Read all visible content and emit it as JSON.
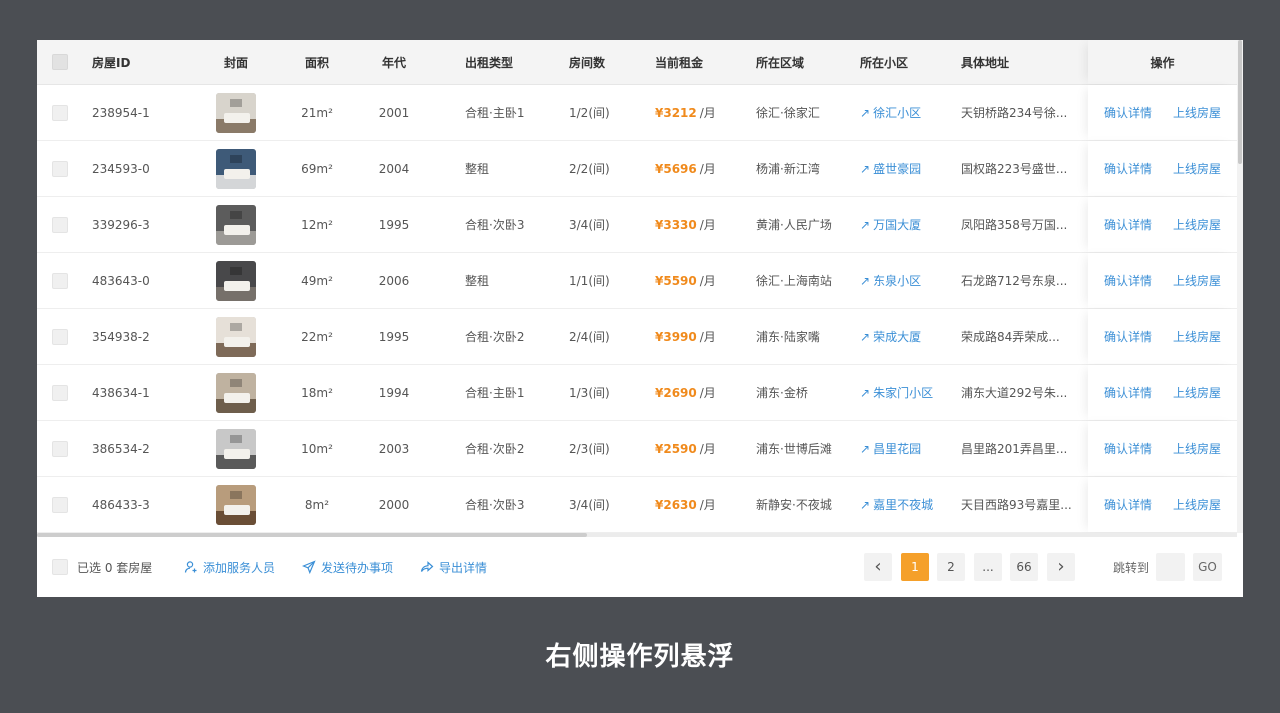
{
  "table": {
    "headers": {
      "house_id": "房屋ID",
      "cover": "封面",
      "area": "面积",
      "year": "年代",
      "rent_type": "出租类型",
      "rooms": "房间数",
      "rent": "当前租金",
      "district": "所在区域",
      "community": "所在小区",
      "address": "具体地址",
      "actions": "操作"
    },
    "rows": [
      {
        "id": "238954-1",
        "area": "21m²",
        "year": "2001",
        "rent_type": "合租·主卧1",
        "rooms": "1/2(间)",
        "price": "¥3212",
        "unit": "/月",
        "district": "徐汇·徐家汇",
        "community": "徐汇小区",
        "address": "天钥桥路234号徐...",
        "action1": "确认详情",
        "action2": "上线房屋",
        "img_wall": "#d8d4cc",
        "img_floor": "#8a7a68"
      },
      {
        "id": "234593-0",
        "area": "69m²",
        "year": "2004",
        "rent_type": "整租",
        "rooms": "2/2(间)",
        "price": "¥5696",
        "unit": "/月",
        "district": "杨浦·新江湾",
        "community": "盛世豪园",
        "address": "国权路223号盛世...",
        "action1": "确认详情",
        "action2": "上线房屋",
        "img_wall": "#3e5a78",
        "img_floor": "#d4d6d8"
      },
      {
        "id": "339296-3",
        "area": "12m²",
        "year": "1995",
        "rent_type": "合租·次卧3",
        "rooms": "3/4(间)",
        "price": "¥3330",
        "unit": "/月",
        "district": "黄浦·人民广场",
        "community": "万国大厦",
        "address": "凤阳路358号万国...",
        "action1": "确认详情",
        "action2": "上线房屋",
        "img_wall": "#5c5c5c",
        "img_floor": "#9c9a96"
      },
      {
        "id": "483643-0",
        "area": "49m²",
        "year": "2006",
        "rent_type": "整租",
        "rooms": "1/1(间)",
        "price": "¥5590",
        "unit": "/月",
        "district": "徐汇·上海南站",
        "community": "东泉小区",
        "address": "石龙路712号东泉...",
        "action1": "确认详情",
        "action2": "上线房屋",
        "img_wall": "#48484a",
        "img_floor": "#76706a"
      },
      {
        "id": "354938-2",
        "area": "22m²",
        "year": "1995",
        "rent_type": "合租·次卧2",
        "rooms": "2/4(间)",
        "price": "¥3990",
        "unit": "/月",
        "district": "浦东·陆家嘴",
        "community": "荣成大厦",
        "address": "荣成路84弄荣成...",
        "action1": "确认详情",
        "action2": "上线房屋",
        "img_wall": "#e6e0d8",
        "img_floor": "#7e6a58"
      },
      {
        "id": "438634-1",
        "area": "18m²",
        "year": "1994",
        "rent_type": "合租·主卧1",
        "rooms": "1/3(间)",
        "price": "¥2690",
        "unit": "/月",
        "district": "浦东·金桥",
        "community": "朱家门小区",
        "address": "浦东大道292号朱...",
        "action1": "确认详情",
        "action2": "上线房屋",
        "img_wall": "#bfb2a0",
        "img_floor": "#6e5e4c"
      },
      {
        "id": "386534-2",
        "area": "10m²",
        "year": "2003",
        "rent_type": "合租·次卧2",
        "rooms": "2/3(间)",
        "price": "¥2590",
        "unit": "/月",
        "district": "浦东·世博后滩",
        "community": "昌里花园",
        "address": "昌里路201弄昌里...",
        "action1": "确认详情",
        "action2": "上线房屋",
        "img_wall": "#c8c8c8",
        "img_floor": "#5a5a5a"
      },
      {
        "id": "486433-3",
        "area": "8m²",
        "year": "2000",
        "rent_type": "合租·次卧3",
        "rooms": "3/4(间)",
        "price": "¥2630",
        "unit": "/月",
        "district": "新静安·不夜城",
        "community": "嘉里不夜城",
        "address": "天目西路93号嘉里...",
        "action1": "确认详情",
        "action2": "上线房屋",
        "img_wall": "#b89c7c",
        "img_floor": "#6a4e36"
      }
    ]
  },
  "footer": {
    "selected_text": "已选 0 套房屋",
    "add_staff": "添加服务人员",
    "send_todo": "发送待办事项",
    "export": "导出详情",
    "pagination": {
      "prev": "‹",
      "pages": [
        "1",
        "2",
        "...",
        "66"
      ],
      "next": "›",
      "jump_label": "跳转到",
      "jump_value": "",
      "go": "GO"
    }
  },
  "caption": "右侧操作列悬浮",
  "colors": {
    "price": "#f08a1c",
    "link": "#3b8fd6",
    "active_page": "#f5a02a"
  }
}
